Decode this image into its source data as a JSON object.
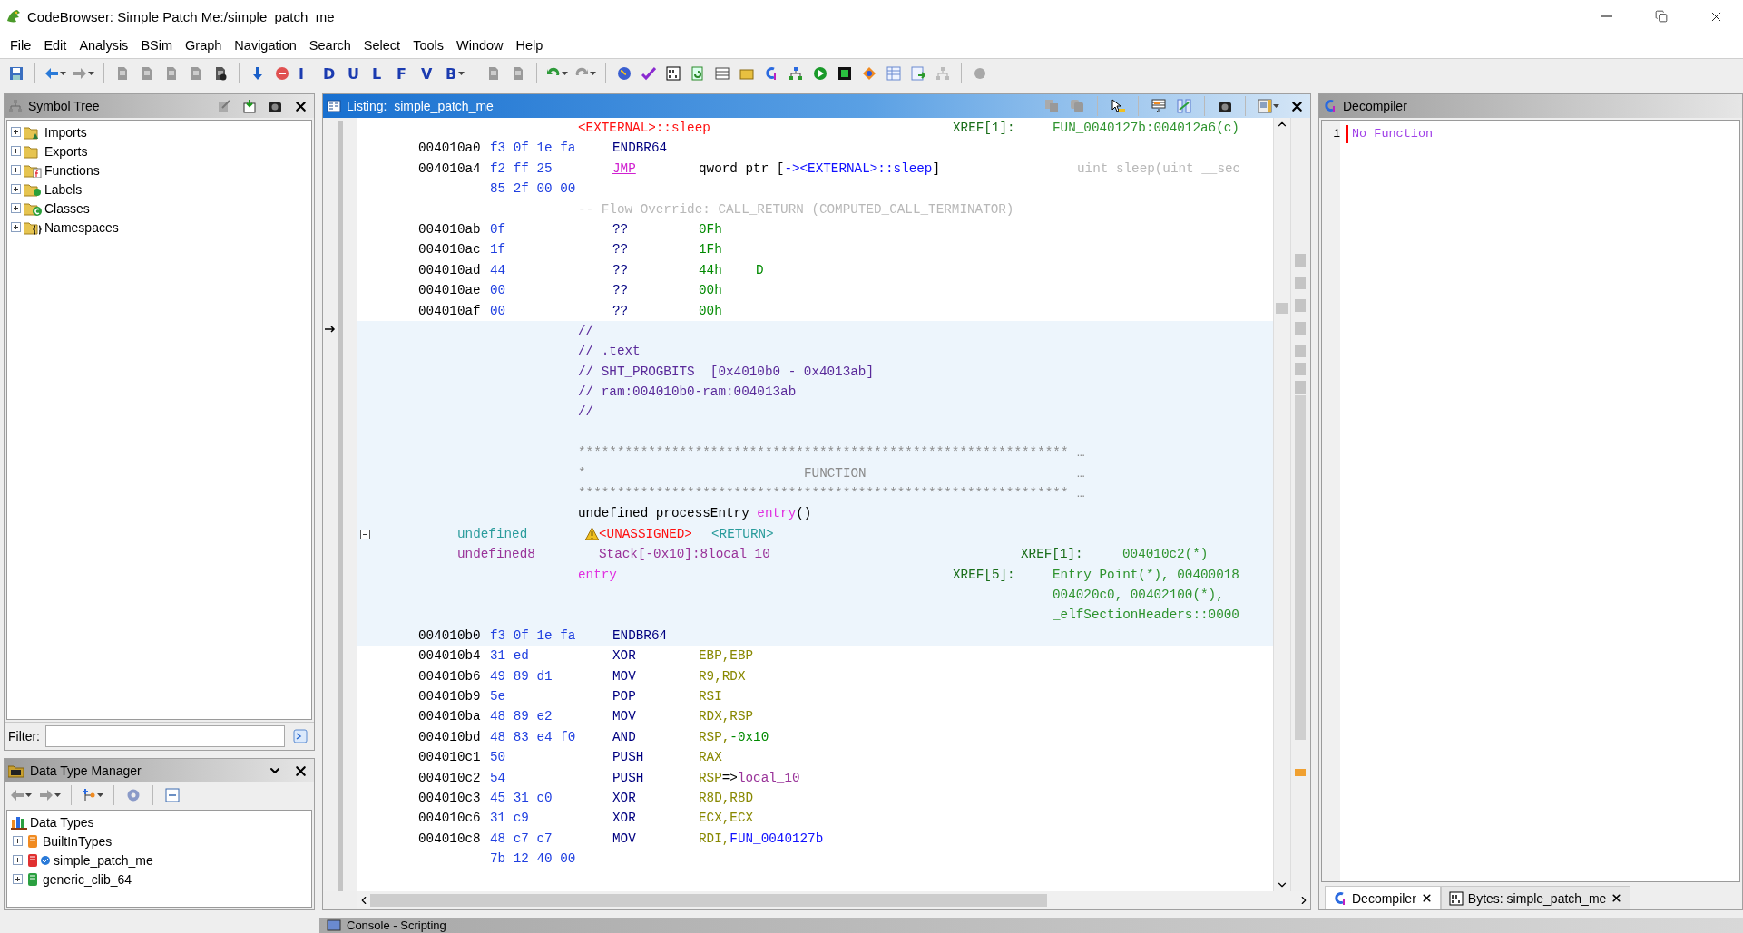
{
  "window": {
    "title": "CodeBrowser: Simple Patch Me:/simple_patch_me"
  },
  "menu": [
    "File",
    "Edit",
    "Analysis",
    "BSim",
    "Graph",
    "Navigation",
    "Search",
    "Select",
    "Tools",
    "Window",
    "Help"
  ],
  "toolbar": {
    "letter_buttons": [
      "I",
      "D",
      "U",
      "L",
      "F",
      "V",
      "B"
    ]
  },
  "symbol_tree": {
    "title": "Symbol Tree",
    "filter_label": "Filter:",
    "items": [
      {
        "label": "Imports",
        "kind": "imports",
        "expanded": false
      },
      {
        "label": "Exports",
        "kind": "exports",
        "expanded": false
      },
      {
        "label": "Functions",
        "kind": "functions",
        "expanded": false
      },
      {
        "label": "Labels",
        "kind": "labels",
        "expanded": false
      },
      {
        "label": "Classes",
        "kind": "classes",
        "expanded": false
      },
      {
        "label": "Namespaces",
        "kind": "namespaces",
        "expanded": false
      }
    ]
  },
  "data_type_manager": {
    "title": "Data Type Manager",
    "root": {
      "label": "Data Types",
      "children": [
        {
          "label": "BuiltInTypes",
          "kind": "builtin",
          "expanded": false
        },
        {
          "label": "simple_patch_me",
          "kind": "program",
          "expanded": false
        },
        {
          "label": "generic_clib_64",
          "kind": "archive",
          "expanded": false
        }
      ]
    }
  },
  "listing": {
    "title": "Listing:  simple_patch_me",
    "lines": [
      {
        "highlighted": false,
        "segs": [
          {
            "kind": "external",
            "text": "<EXTERNAL>::sleep"
          },
          {
            "kind": "xref",
            "text": "XREF[1]:"
          },
          {
            "kind": "xrefs",
            "text": "FUN_0040127b:004012a6(c)"
          }
        ]
      },
      {
        "highlighted": false,
        "segs": [
          {
            "kind": "address",
            "text": "004010a0"
          },
          {
            "kind": "bytes",
            "text": "f3 0f 1e fa"
          },
          {
            "kind": "mnemonic",
            "text": "ENDBR64"
          }
        ]
      },
      {
        "highlighted": false,
        "segs": [
          {
            "kind": "address",
            "text": "004010a4"
          },
          {
            "kind": "bytes",
            "text": "f2 ff 25"
          },
          {
            "kind": "flow",
            "text": "JMP"
          },
          {
            "kind": "operand",
            "runs": [
              {
                "text": "qword ptr [",
                "kind": "plain"
              },
              {
                "text": "-><EXTERNAL>::sleep",
                "kind": "ref"
              },
              {
                "text": "]",
                "kind": "plain"
              }
            ]
          },
          {
            "kind": "comment",
            "text": "uint sleep(uint __sec"
          }
        ]
      },
      {
        "highlighted": false,
        "segs": [
          {
            "kind": "bytes",
            "text": "85 2f 00 00"
          }
        ]
      },
      {
        "highlighted": false,
        "segs": [
          {
            "kind": "note",
            "text": "-- Flow Override: CALL_RETURN (COMPUTED_CALL_TERMINATOR)"
          }
        ]
      },
      {
        "highlighted": false,
        "segs": [
          {
            "kind": "address",
            "text": "004010ab"
          },
          {
            "kind": "bytes",
            "text": "0f"
          },
          {
            "kind": "mnemonic",
            "text": "??"
          },
          {
            "kind": "scalar",
            "text": "0Fh"
          }
        ]
      },
      {
        "highlighted": false,
        "segs": [
          {
            "kind": "address",
            "text": "004010ac"
          },
          {
            "kind": "bytes",
            "text": "1f"
          },
          {
            "kind": "mnemonic",
            "text": "??"
          },
          {
            "kind": "scalar",
            "text": "1Fh"
          }
        ]
      },
      {
        "highlighted": false,
        "segs": [
          {
            "kind": "address",
            "text": "004010ad"
          },
          {
            "kind": "bytes",
            "text": "44"
          },
          {
            "kind": "mnemonic",
            "text": "??"
          },
          {
            "kind": "scalar",
            "text": "44h"
          },
          {
            "kind": "char",
            "text": "D"
          }
        ]
      },
      {
        "highlighted": false,
        "segs": [
          {
            "kind": "address",
            "text": "004010ae"
          },
          {
            "kind": "bytes",
            "text": "00"
          },
          {
            "kind": "mnemonic",
            "text": "??"
          },
          {
            "kind": "scalar",
            "text": "00h"
          }
        ]
      },
      {
        "highlighted": false,
        "segs": [
          {
            "kind": "address",
            "text": "004010af"
          },
          {
            "kind": "bytes",
            "text": "00"
          },
          {
            "kind": "mnemonic",
            "text": "??"
          },
          {
            "kind": "scalar",
            "text": "00h"
          }
        ]
      },
      {
        "highlighted": true,
        "segs": [
          {
            "kind": "plate",
            "text": "//"
          }
        ]
      },
      {
        "highlighted": true,
        "segs": [
          {
            "kind": "plate",
            "text": "// .text"
          }
        ]
      },
      {
        "highlighted": true,
        "segs": [
          {
            "kind": "plate",
            "text": "// SHT_PROGBITS  [0x4010b0 - 0x4013ab]"
          }
        ]
      },
      {
        "highlighted": true,
        "segs": [
          {
            "kind": "plate",
            "text": "// ram:004010b0-ram:004013ab"
          }
        ]
      },
      {
        "highlighted": true,
        "segs": [
          {
            "kind": "plate",
            "text": "//"
          }
        ]
      },
      {
        "highlighted": true
      },
      {
        "highlighted": true,
        "segs": [
          {
            "kind": "banner",
            "text": "***************************************************************"
          },
          {
            "kind": "bannerend",
            "text": "…"
          }
        ]
      },
      {
        "highlighted": true,
        "segs": [
          {
            "kind": "banner",
            "text": "*"
          },
          {
            "kind": "bannermid",
            "text": "FUNCTION"
          },
          {
            "kind": "bannerend",
            "text": "…"
          }
        ]
      },
      {
        "highlighted": true,
        "segs": [
          {
            "kind": "banner",
            "text": "***************************************************************"
          },
          {
            "kind": "bannerend",
            "text": "…"
          }
        ]
      },
      {
        "highlighted": true,
        "segs": [
          {
            "kind": "signature",
            "runs": [
              {
                "text": "undefined processEntry ",
                "kind": "plain"
              },
              {
                "text": "entry",
                "kind": "label"
              },
              {
                "text": "()",
                "kind": "plain"
              }
            ]
          }
        ]
      },
      {
        "highlighted": true,
        "segs": [
          {
            "kind": "collapse",
            "expanded": true
          },
          {
            "kind": "returntype",
            "text": "undefined"
          },
          {
            "kind": "unassigned",
            "text": "<UNASSIGNED>",
            "warning": true
          },
          {
            "kind": "returnname",
            "text": "<RETURN>"
          }
        ]
      },
      {
        "highlighted": true,
        "segs": [
          {
            "kind": "vartype",
            "text": "undefined8"
          },
          {
            "kind": "storage",
            "text": "Stack[-0x10]:8local_10",
            "warning": false
          },
          {
            "kind": "xrefalt",
            "text": "XREF[1]:"
          },
          {
            "kind": "xrefsalt",
            "text": "004010c2(*)"
          }
        ]
      },
      {
        "highlighted": true,
        "segs": [
          {
            "kind": "label",
            "text": "entry"
          },
          {
            "kind": "xref",
            "text": "XREF[5]:"
          },
          {
            "kind": "xrefs",
            "text": "Entry Point(*), 00400018"
          }
        ]
      },
      {
        "highlighted": true,
        "segs": [
          {
            "kind": "xrefs",
            "text": "004020c0, 00402100(*),"
          }
        ]
      },
      {
        "highlighted": true,
        "segs": [
          {
            "kind": "xrefs",
            "text": "_elfSectionHeaders::0000"
          }
        ]
      },
      {
        "highlighted": true,
        "segs": [
          {
            "kind": "address",
            "text": "004010b0"
          },
          {
            "kind": "bytes",
            "text": "f3 0f 1e fa"
          },
          {
            "kind": "mnemonic",
            "text": "ENDBR64"
          }
        ]
      },
      {
        "highlighted": false,
        "segs": [
          {
            "kind": "address",
            "text": "004010b4"
          },
          {
            "kind": "bytes",
            "text": "31 ed"
          },
          {
            "kind": "mnemonic",
            "text": "XOR"
          },
          {
            "kind": "register",
            "text": "EBP,EBP"
          }
        ]
      },
      {
        "highlighted": false,
        "segs": [
          {
            "kind": "address",
            "text": "004010b6"
          },
          {
            "kind": "bytes",
            "text": "49 89 d1"
          },
          {
            "kind": "mnemonic",
            "text": "MOV"
          },
          {
            "kind": "register",
            "text": "R9,RDX"
          }
        ]
      },
      {
        "highlighted": false,
        "segs": [
          {
            "kind": "address",
            "text": "004010b9"
          },
          {
            "kind": "bytes",
            "text": "5e"
          },
          {
            "kind": "mnemonic",
            "text": "POP"
          },
          {
            "kind": "register",
            "text": "RSI"
          }
        ]
      },
      {
        "highlighted": false,
        "segs": [
          {
            "kind": "address",
            "text": "004010ba"
          },
          {
            "kind": "bytes",
            "text": "48 89 e2"
          },
          {
            "kind": "mnemonic",
            "text": "MOV"
          },
          {
            "kind": "register",
            "text": "RDX,RSP"
          }
        ]
      },
      {
        "highlighted": false,
        "segs": [
          {
            "kind": "address",
            "text": "004010bd"
          },
          {
            "kind": "bytes",
            "text": "48 83 e4 f0"
          },
          {
            "kind": "mnemonic",
            "text": "AND"
          },
          {
            "kind": "operand",
            "runs": [
              {
                "text": "RSP,",
                "kind": "register"
              },
              {
                "text": "-0x10",
                "kind": "scalar"
              }
            ]
          }
        ]
      },
      {
        "highlighted": false,
        "segs": [
          {
            "kind": "address",
            "text": "004010c1"
          },
          {
            "kind": "bytes",
            "text": "50"
          },
          {
            "kind": "mnemonic",
            "text": "PUSH"
          },
          {
            "kind": "register",
            "text": "RAX"
          }
        ]
      },
      {
        "highlighted": false,
        "segs": [
          {
            "kind": "address",
            "text": "004010c2"
          },
          {
            "kind": "bytes",
            "text": "54"
          },
          {
            "kind": "mnemonic",
            "text": "PUSH"
          },
          {
            "kind": "operand",
            "runs": [
              {
                "text": "RSP",
                "kind": "register"
              },
              {
                "text": "=>",
                "kind": "plain"
              },
              {
                "text": "local_10",
                "kind": "var"
              }
            ]
          }
        ]
      },
      {
        "highlighted": false,
        "segs": [
          {
            "kind": "address",
            "text": "004010c3"
          },
          {
            "kind": "bytes",
            "text": "45 31 c0"
          },
          {
            "kind": "mnemonic",
            "text": "XOR"
          },
          {
            "kind": "register",
            "text": "R8D,R8D"
          }
        ]
      },
      {
        "highlighted": false,
        "segs": [
          {
            "kind": "address",
            "text": "004010c6"
          },
          {
            "kind": "bytes",
            "text": "31 c9"
          },
          {
            "kind": "mnemonic",
            "text": "XOR"
          },
          {
            "kind": "register",
            "text": "ECX,ECX"
          }
        ]
      },
      {
        "highlighted": false,
        "segs": [
          {
            "kind": "address",
            "text": "004010c8"
          },
          {
            "kind": "bytes",
            "text": "48 c7 c7"
          },
          {
            "kind": "mnemonic",
            "text": "MOV"
          },
          {
            "kind": "operand",
            "runs": [
              {
                "text": "RDI,",
                "kind": "register"
              },
              {
                "text": "FUN_0040127b",
                "kind": "ref"
              }
            ]
          }
        ]
      },
      {
        "highlighted": false,
        "segs": [
          {
            "kind": "bytes",
            "text": "7b 12 40 00"
          }
        ]
      }
    ]
  },
  "decompiler": {
    "title": "Decompiler",
    "lines": [
      {
        "number": "1",
        "text": "No Function"
      }
    ],
    "tabs": [
      {
        "label": "Decompiler",
        "kind": "decompiler",
        "selected": true
      },
      {
        "label": "Bytes: simple_patch_me",
        "kind": "bytes",
        "selected": false
      }
    ]
  },
  "console": {
    "title": "Console - Scripting"
  }
}
